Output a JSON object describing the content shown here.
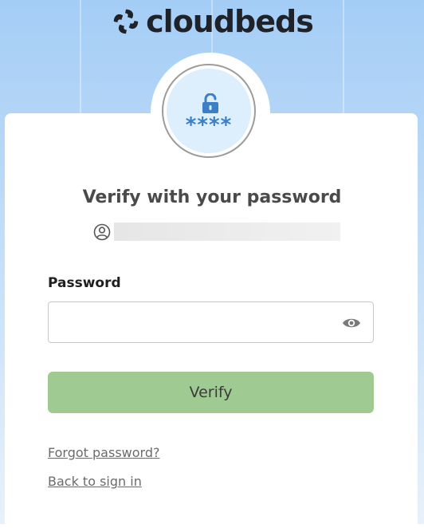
{
  "brand": {
    "name": "cloudbeds",
    "logo_icon": "cloudbeds-logo-icon"
  },
  "badge": {
    "icon": "unlocked-padlock-icon",
    "masked_text": "****",
    "accent_color": "#3b80c7",
    "background_color": "#ddeefc"
  },
  "heading": {
    "title": "Verify with your password"
  },
  "user": {
    "icon": "user-circle-icon"
  },
  "form": {
    "password_label": "Password",
    "password_value": "",
    "reveal_icon": "eye-icon",
    "submit_label": "Verify",
    "submit_color": "#9fcb92"
  },
  "links": {
    "forgot_password": "Forgot password?",
    "back_to_sign_in": "Back to sign in"
  }
}
